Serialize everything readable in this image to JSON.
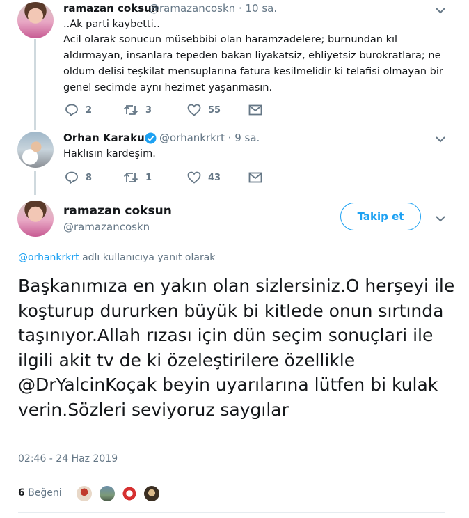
{
  "tweet1": {
    "name": "ramazan coksun",
    "handle": "@ramazancoskn",
    "time": "· 10 sa.",
    "line1": "..Ak parti kaybetti..",
    "body": "Acil olarak sonucun müsebbibi olan haramzadelere; burnundan kıl aldırmayan, insanlara tepeden bakan liyakatsiz, ehliyetsiz burokratlara; ne oldum delisi teşkilat mensuplarına fatura kesilmelidir ki telafisi olmayan bir genel secimde aynı hezimet yaşanmasın.",
    "replies": "2",
    "retweets": "3",
    "likes": "55"
  },
  "tweet2": {
    "name": "Orhan Karakurt",
    "handle": "@orhankrkrt",
    "time": "· 9 sa.",
    "body": "Haklısın kardeşim.",
    "replies": "8",
    "retweets": "1",
    "likes": "43"
  },
  "main": {
    "name": "ramazan coksun",
    "handle": "@ramazancoskn",
    "follow_label": "Takip et",
    "reply_handle": "@orhankrkrt",
    "reply_suffix": "adlı kullanıcıya yanıt olarak",
    "text": "Başkanımıza en yakın olan sizlersiniz.O herşeyi ile koşturup dururken büyük bi kitlede onun sırtında taşınıyor.Allah rızası için dün seçim sonuçlari ile ilgili akit tv de ki özeleştirilere özellikle @DrYalcinKoçak beyin uyarılarına lütfen bi kulak verin.Sözleri seviyoruz saygılar",
    "timestamp": "02:46 - 24 Haz 2019",
    "like_count": "6",
    "like_label": "Beğeni"
  },
  "colors": {
    "accent": "#1da1f2",
    "muted": "#657786",
    "text": "#14171a"
  }
}
